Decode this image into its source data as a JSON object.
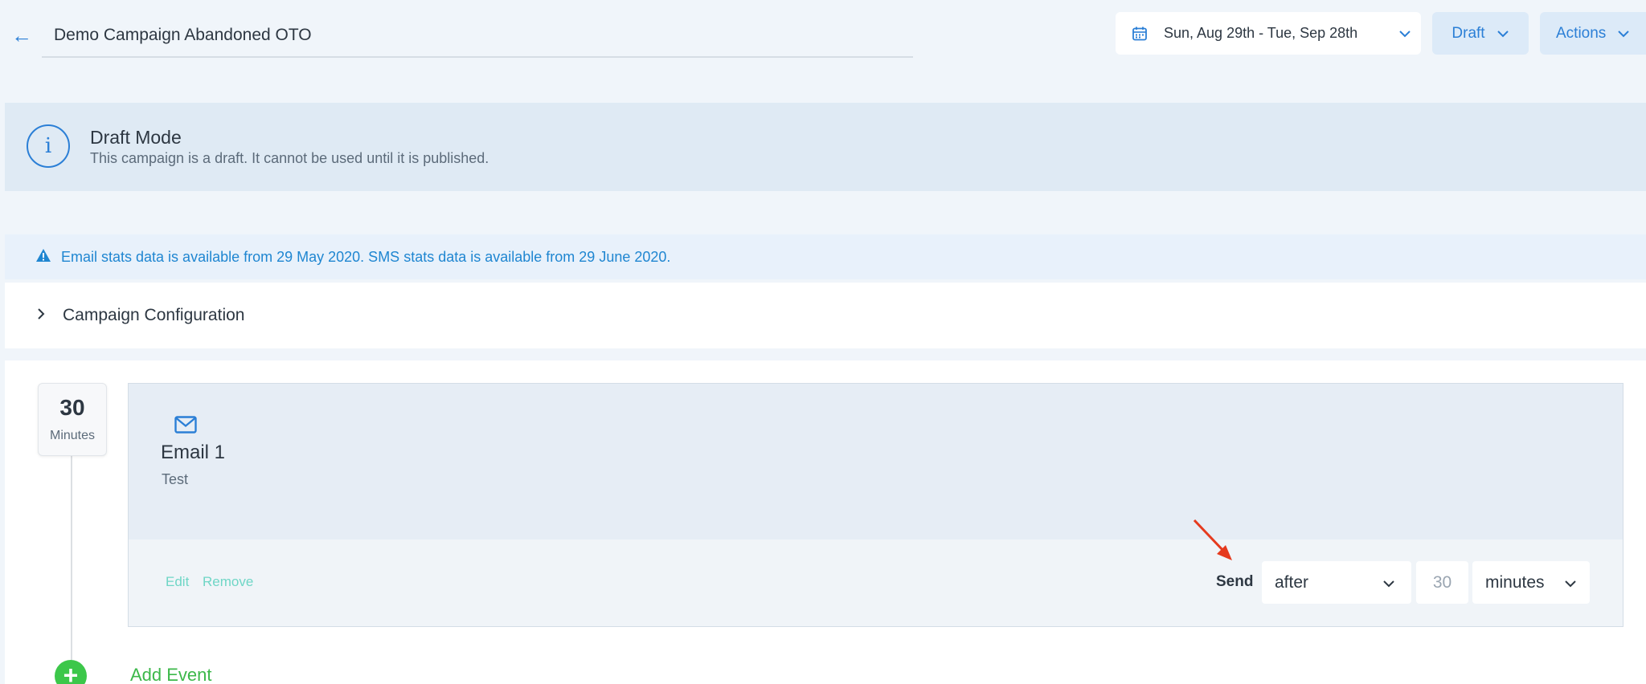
{
  "header": {
    "title": "Demo Campaign Abandoned OTO",
    "date_range": "Sun, Aug 29th - Tue, Sep 28th",
    "draft_label": "Draft",
    "actions_label": "Actions"
  },
  "draft_banner": {
    "title": "Draft Mode",
    "message": "This campaign is a draft. It cannot be used until it is published."
  },
  "stats_notice": {
    "message": "Email stats data is available from 29 May 2020. SMS stats data is available from 29 June 2020."
  },
  "config": {
    "label": "Campaign Configuration"
  },
  "event": {
    "delay_value": "30",
    "delay_unit": "Minutes",
    "name": "Email 1",
    "description": "Test",
    "edit_label": "Edit",
    "remove_label": "Remove",
    "send_label": "Send",
    "timing_option": "after",
    "amount_placeholder": "30",
    "unit_option": "minutes"
  },
  "add_event_label": "Add Event",
  "colors": {
    "accent": "#2b7fd6",
    "success": "#3cc74a",
    "link": "#6fd6c6",
    "annotation_arrow": "#e53a1e"
  }
}
